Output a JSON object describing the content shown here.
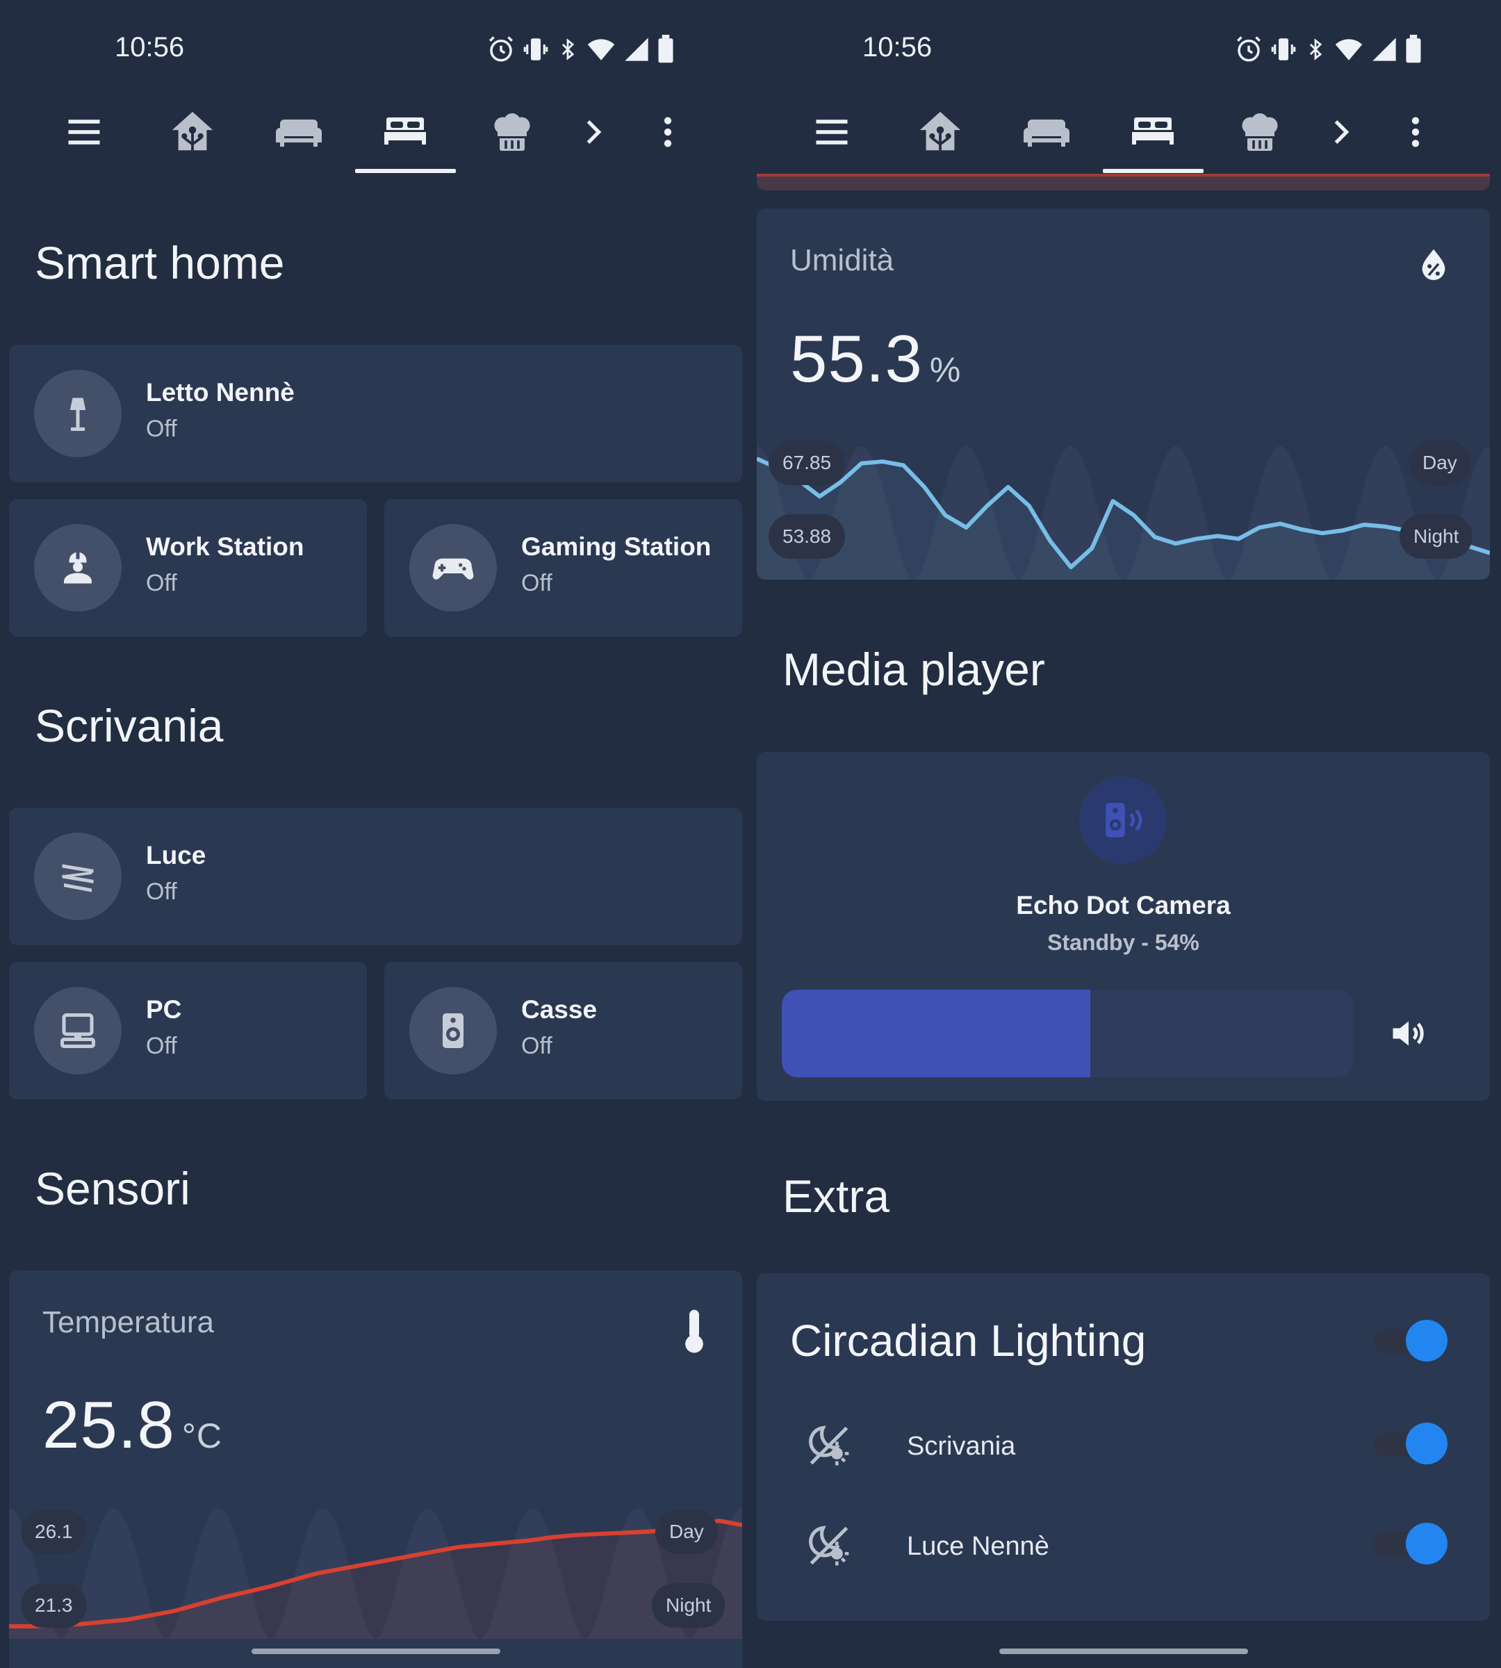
{
  "status_bar": {
    "time": "10:56"
  },
  "toolbar": {
    "icons": [
      "menu-icon",
      "home-automation-icon",
      "sofa-icon",
      "bed-icon",
      "chef-hat-icon",
      "chevron-right-icon",
      "more-vertical-icon"
    ],
    "active_tab": "bed-icon"
  },
  "left": {
    "smart_home": {
      "title": "Smart home",
      "letto": {
        "name": "Letto Nennè",
        "state": "Off"
      },
      "work": {
        "name": "Work Station",
        "state": "Off"
      },
      "gaming": {
        "name": "Gaming Station",
        "state": "Off"
      }
    },
    "scrivania": {
      "title": "Scrivania",
      "luce": {
        "name": "Luce",
        "state": "Off"
      },
      "pc": {
        "name": "PC",
        "state": "Off"
      },
      "casse": {
        "name": "Casse",
        "state": "Off"
      }
    },
    "sensori": {
      "title": "Sensori",
      "temperatura": {
        "label": "Temperatura",
        "value": "25.8",
        "unit": "°C",
        "max_label": "26.1",
        "min_label": "21.3",
        "day_label": "Day",
        "night_label": "Night",
        "line_color": "#d9402f",
        "series": [
          21.3,
          21.3,
          21.35,
          21.4,
          21.5,
          21.6,
          21.8,
          22.0,
          22.3,
          22.6,
          22.85,
          23.1,
          23.4,
          23.7,
          23.9,
          24.1,
          24.3,
          24.5,
          24.7,
          24.9,
          25.0,
          25.1,
          25.2,
          25.35,
          25.45,
          25.5,
          25.55,
          25.6,
          25.7,
          25.8,
          26.1,
          25.9
        ]
      }
    }
  },
  "right": {
    "umidita": {
      "label": "Umidità",
      "value": "55.3",
      "unit": "%",
      "max_label": "67.85",
      "min_label": "53.88",
      "day_label": "Day",
      "night_label": "Night",
      "line_color": "#77bde8",
      "series": [
        66.5,
        65.5,
        64.2,
        62.5,
        64.0,
        66.0,
        66.2,
        65.8,
        63.5,
        60.5,
        59.2,
        61.5,
        63.5,
        61.5,
        57.8,
        55.0,
        57.0,
        62.0,
        60.5,
        58.2,
        57.5,
        58.0,
        58.3,
        58.0,
        59.2,
        59.6,
        59.0,
        58.6,
        58.9,
        59.5,
        59.3,
        58.9,
        58.5,
        58.0,
        57.2,
        56.5
      ]
    },
    "media_player": {
      "title": "Media player",
      "device": "Echo Dot Camera",
      "status": "Standby - 54%",
      "volume": 54
    },
    "extra": {
      "title": "Extra",
      "circadian": {
        "title": "Circadian Lighting",
        "items": [
          {
            "label": "Scrivania"
          },
          {
            "label": "Luce Nennè"
          }
        ]
      }
    }
  },
  "colors": {
    "background": "#222d41",
    "card": "#2b3852",
    "accent_blue": "#2386f0",
    "volume_fill": "#3f51b5"
  }
}
